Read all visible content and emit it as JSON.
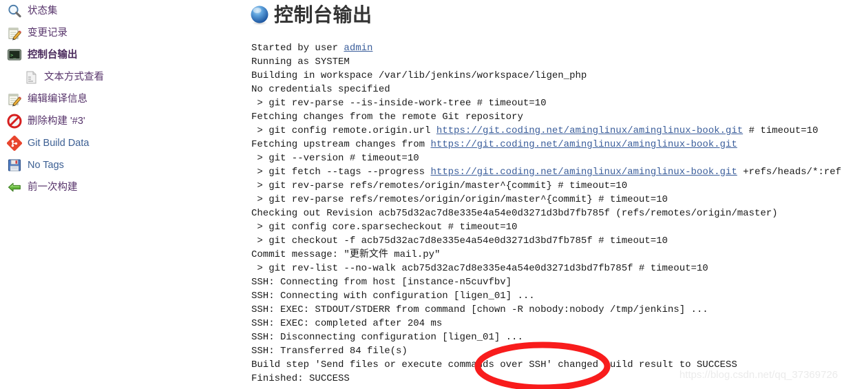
{
  "sidebar": {
    "items": [
      {
        "icon": "magnifier-icon",
        "label": "状态集",
        "lang": "zh",
        "active": false,
        "sub": false
      },
      {
        "icon": "notepad-pencil-icon",
        "label": "变更记录",
        "lang": "zh",
        "active": false,
        "sub": false
      },
      {
        "icon": "terminal-icon",
        "label": "控制台输出",
        "lang": "zh",
        "active": true,
        "sub": false
      },
      {
        "icon": "document-icon",
        "label": "文本方式查看",
        "lang": "zh",
        "active": false,
        "sub": true
      },
      {
        "icon": "notepad-pencil-icon",
        "label": "编辑编译信息",
        "lang": "zh",
        "active": false,
        "sub": false
      },
      {
        "icon": "no-entry-icon",
        "label": "删除构建 '#3'",
        "lang": "zh",
        "active": false,
        "sub": false
      },
      {
        "icon": "git-icon",
        "label": "Git Build Data",
        "lang": "en",
        "active": false,
        "sub": false
      },
      {
        "icon": "floppy-icon",
        "label": "No Tags",
        "lang": "en",
        "active": false,
        "sub": false
      },
      {
        "icon": "green-left-arrow-icon",
        "label": "前一次构建",
        "lang": "zh",
        "active": false,
        "sub": false
      }
    ]
  },
  "header": {
    "icon": "blue-ball-icon",
    "title": "控制台输出"
  },
  "console": {
    "lines": [
      {
        "parts": [
          {
            "t": "Started by user "
          },
          {
            "t": "admin",
            "link": true
          }
        ]
      },
      {
        "parts": [
          {
            "t": "Running as SYSTEM"
          }
        ]
      },
      {
        "parts": [
          {
            "t": "Building in workspace /var/lib/jenkins/workspace/ligen_php"
          }
        ]
      },
      {
        "parts": [
          {
            "t": "No credentials specified"
          }
        ]
      },
      {
        "parts": [
          {
            "t": " > git rev-parse --is-inside-work-tree # timeout=10"
          }
        ]
      },
      {
        "parts": [
          {
            "t": "Fetching changes from the remote Git repository"
          }
        ]
      },
      {
        "parts": [
          {
            "t": " > git config remote.origin.url "
          },
          {
            "t": "https://git.coding.net/aminglinux/aminglinux-book.git",
            "link": true
          },
          {
            "t": " # timeout=10"
          }
        ]
      },
      {
        "parts": [
          {
            "t": "Fetching upstream changes from "
          },
          {
            "t": "https://git.coding.net/aminglinux/aminglinux-book.git",
            "link": true
          }
        ]
      },
      {
        "parts": [
          {
            "t": " > git --version # timeout=10"
          }
        ]
      },
      {
        "parts": [
          {
            "t": " > git fetch --tags --progress "
          },
          {
            "t": "https://git.coding.net/aminglinux/aminglinux-book.git",
            "link": true
          },
          {
            "t": " +refs/heads/*:ref"
          }
        ]
      },
      {
        "parts": [
          {
            "t": " > git rev-parse refs/remotes/origin/master^{commit} # timeout=10"
          }
        ]
      },
      {
        "parts": [
          {
            "t": " > git rev-parse refs/remotes/origin/origin/master^{commit} # timeout=10"
          }
        ]
      },
      {
        "parts": [
          {
            "t": "Checking out Revision acb75d32ac7d8e335e4a54e0d3271d3bd7fb785f (refs/remotes/origin/master)"
          }
        ]
      },
      {
        "parts": [
          {
            "t": " > git config core.sparsecheckout # timeout=10"
          }
        ]
      },
      {
        "parts": [
          {
            "t": " > git checkout -f acb75d32ac7d8e335e4a54e0d3271d3bd7fb785f # timeout=10"
          }
        ]
      },
      {
        "parts": [
          {
            "t": "Commit message: \"更新文件 mail.py\""
          }
        ]
      },
      {
        "parts": [
          {
            "t": " > git rev-list --no-walk acb75d32ac7d8e335e4a54e0d3271d3bd7fb785f # timeout=10"
          }
        ]
      },
      {
        "parts": [
          {
            "t": "SSH: Connecting from host [instance-n5cuvfbv]"
          }
        ]
      },
      {
        "parts": [
          {
            "t": "SSH: Connecting with configuration [ligen_01] ..."
          }
        ]
      },
      {
        "parts": [
          {
            "t": "SSH: EXEC: STDOUT/STDERR from command [chown -R nobody:nobody /tmp/jenkins] ..."
          }
        ]
      },
      {
        "parts": [
          {
            "t": "SSH: EXEC: completed after 204 ms"
          }
        ]
      },
      {
        "parts": [
          {
            "t": "SSH: Disconnecting configuration [ligen_01] ..."
          }
        ]
      },
      {
        "parts": [
          {
            "t": "SSH: Transferred 84 file(s)"
          }
        ]
      },
      {
        "parts": [
          {
            "t": "Build step 'Send files or execute commands over SSH' changed build result to SUCCESS"
          }
        ]
      },
      {
        "parts": [
          {
            "t": "Finished: SUCCESS"
          }
        ]
      }
    ]
  },
  "annotation": {
    "shape": "red-ellipse",
    "color": "#f81c1c"
  },
  "watermark": {
    "text": "https://blog.csdn.net/qq_37369726"
  }
}
